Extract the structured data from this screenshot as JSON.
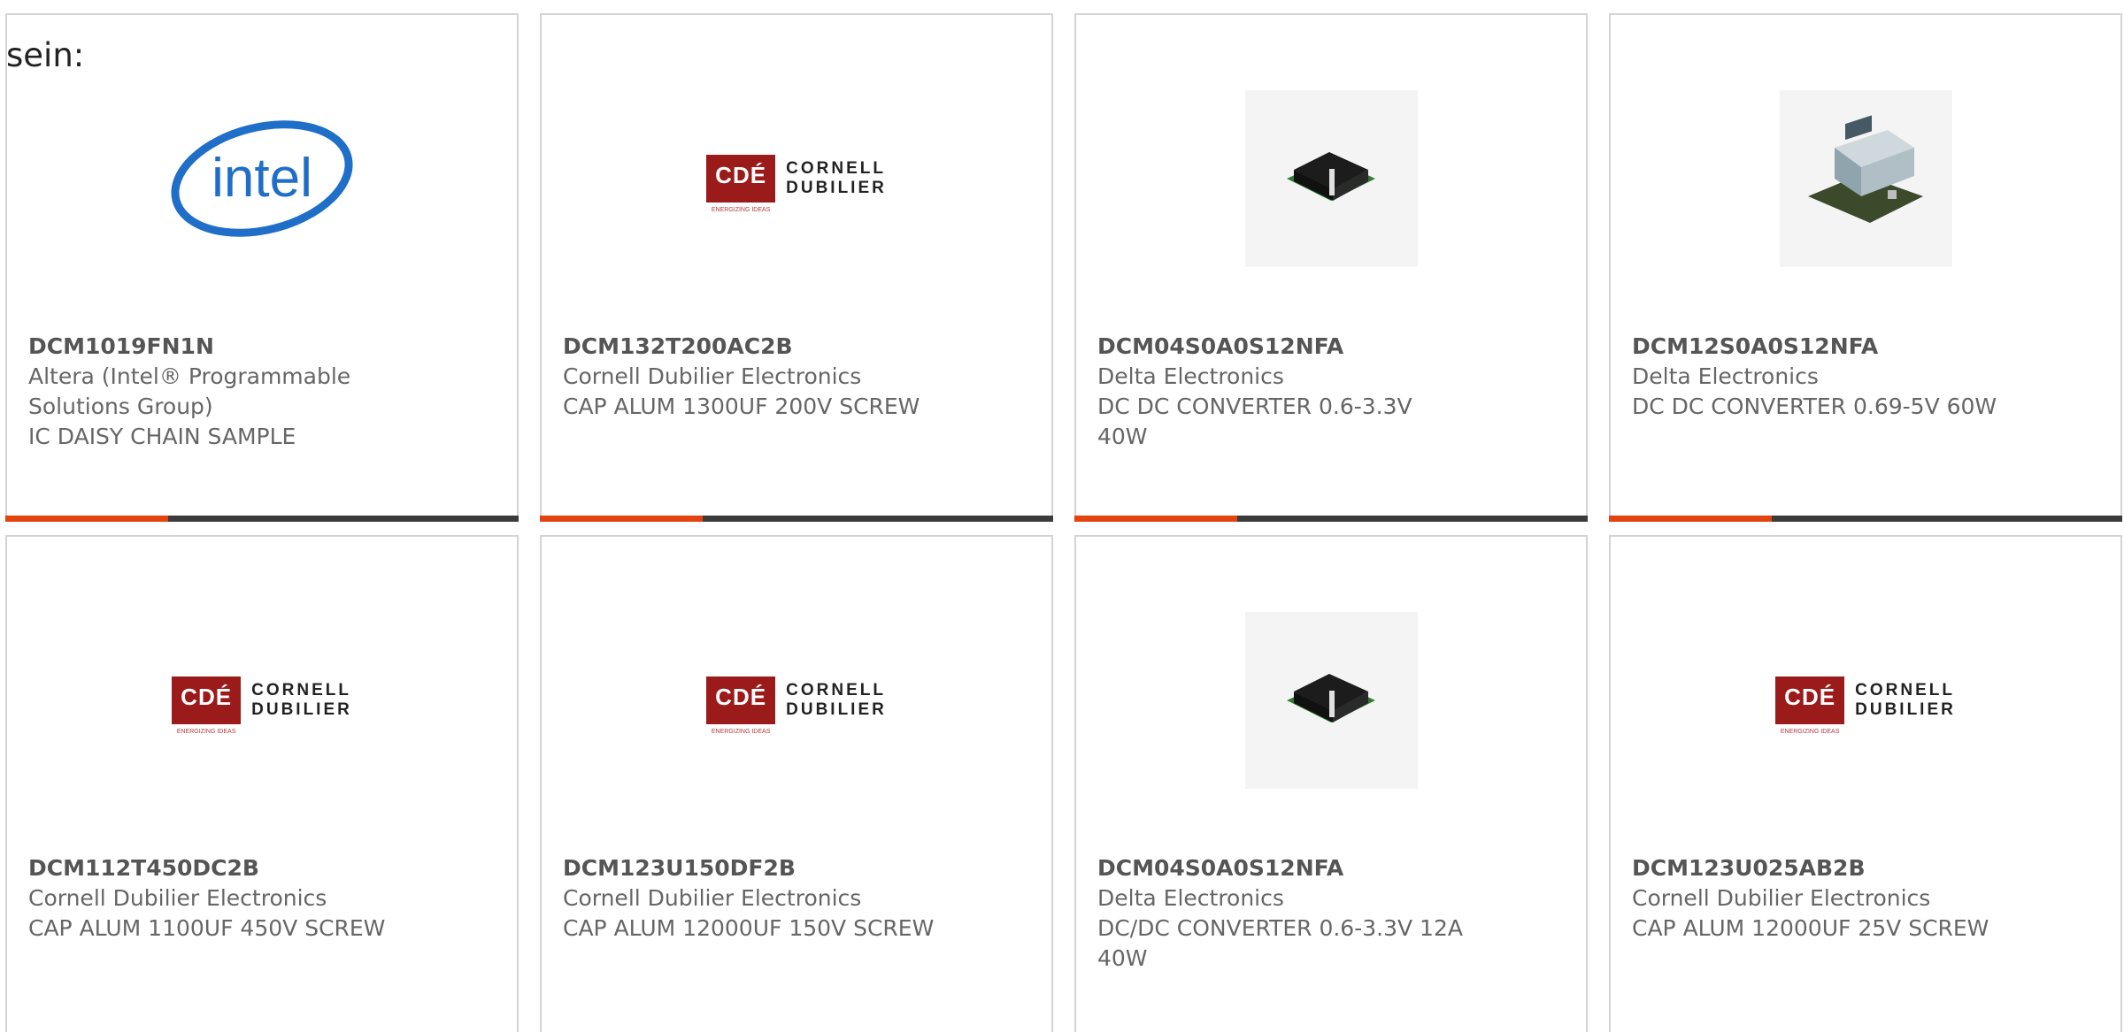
{
  "intro": "sein:",
  "colors": {
    "accent": "#e2430f",
    "bar_dark": "#3b3b3b",
    "cde_red": "#9b1b1b",
    "intel_blue": "#1f6fc9"
  },
  "products": [
    {
      "part": "DCM1019FN1N",
      "manufacturer": "Altera (Intel® Programmable Solutions Group)",
      "description": "IC DAISY CHAIN SAMPLE",
      "image": "intel-logo"
    },
    {
      "part": "DCM132T200AC2B",
      "manufacturer": "Cornell Dubilier Electronics",
      "description": "CAP ALUM 1300UF 200V SCREW",
      "image": "cde-logo"
    },
    {
      "part": "DCM04S0A0S12NFA",
      "manufacturer": "Delta Electronics",
      "description": "DC DC CONVERTER 0.6-3.3V 40W",
      "image": "dc-converter-photo"
    },
    {
      "part": "DCM12S0A0S12NFA",
      "manufacturer": "Delta Electronics",
      "description": "DC DC CONVERTER 0.69-5V 60W",
      "image": "dc-converter-module-photo"
    },
    {
      "part": "DCM112T450DC2B",
      "manufacturer": "Cornell Dubilier Electronics",
      "description": "CAP ALUM 1100UF 450V SCREW",
      "image": "cde-logo"
    },
    {
      "part": "DCM123U150DF2B",
      "manufacturer": "Cornell Dubilier Electronics",
      "description": "CAP ALUM 12000UF 150V SCREW",
      "image": "cde-logo"
    },
    {
      "part": "DCM04S0A0S12NFA",
      "manufacturer": "Delta Electronics",
      "description": "DC/DC CONVERTER 0.6-3.3V 12A 40W",
      "image": "dc-converter-photo"
    },
    {
      "part": "DCM123U025AB2B",
      "manufacturer": "Cornell Dubilier Electronics",
      "description": "CAP ALUM 12000UF 25V SCREW",
      "image": "cde-logo"
    }
  ],
  "logos": {
    "intel_text": "intel",
    "cde_letters": "CDÉ",
    "cde_tagline": "ENERGIZING IDEAS",
    "cde_line1": "CORNELL",
    "cde_line2": "DUBILIER"
  }
}
